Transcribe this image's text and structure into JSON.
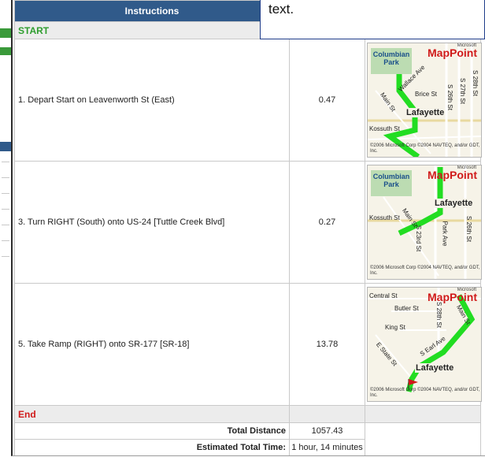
{
  "header": {
    "instructions": "Instructions"
  },
  "start_label": "START",
  "steps": [
    {
      "instruction": "1. Depart Start on Leavenworth St (East)",
      "distance": "0.47",
      "map": {
        "park": "Columbian Park",
        "brand": "MapPoint",
        "brand_small": "Microsoft",
        "city": "Lafayette",
        "labels": [
          "Wallace Ave",
          "Brice St",
          "Main St",
          "Kossuth St",
          "S 26th St",
          "S 27th St",
          "S 28th St"
        ],
        "copyright": "©2006 Microsoft Corp ©2004 NAVTEQ, and/or GDT, Inc."
      }
    },
    {
      "instruction": "3. Turn RIGHT (South) onto US-24 [Tuttle Creek Blvd]",
      "distance": "0.27",
      "map": {
        "park": "Columbian Park",
        "brand": "MapPoint",
        "brand_small": "Microsoft",
        "city": "Lafayette",
        "labels": [
          "Main St",
          "Kossuth St",
          "S 23rd St",
          "Park Ave",
          "S 26th St"
        ],
        "copyright": "©2006 Microsoft Corp ©2004 NAVTEQ, and/or GDT, Inc."
      }
    },
    {
      "instruction": "5. Take Ramp (RIGHT) onto SR-177 [SR-18]",
      "distance": "13.78",
      "map": {
        "brand": "MapPoint",
        "brand_small": "Microsoft",
        "city": "Lafayette",
        "labels": [
          "Central St",
          "Butler St",
          "King St",
          "E State St",
          "S Earl Ave",
          "S 28th St",
          "Main St"
        ],
        "copyright": "©2006 Microsoft Corp ©2004 NAVTEQ, and/or GDT, Inc."
      }
    }
  ],
  "end_label": "End",
  "totals": {
    "distance_label": "Total Distance",
    "distance_value": "1057.43",
    "time_label": "Estimated Total Time:",
    "time_value": "1 hour, 14 minutes"
  },
  "note": {
    "text": "text."
  },
  "colors": {
    "header_bg": "#305a8a",
    "start": "#2f9e2f",
    "end": "#d01a1a",
    "route": "#22dd22"
  }
}
